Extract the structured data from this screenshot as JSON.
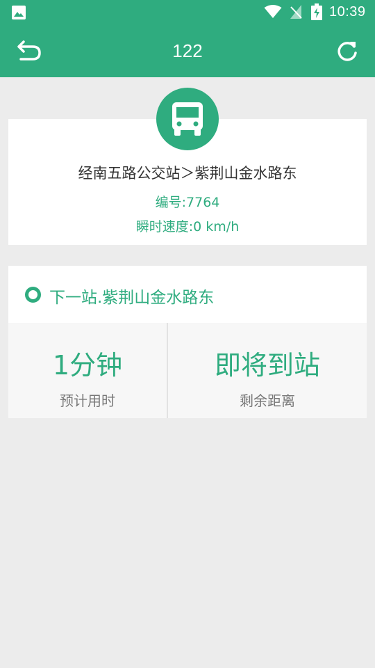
{
  "status_bar": {
    "time": "10:39",
    "icons": [
      "photo-icon",
      "wifi-icon",
      "no-signal-icon",
      "battery-charging-icon"
    ]
  },
  "toolbar": {
    "title": "122",
    "back_icon": "back-icon",
    "refresh_icon": "refresh-icon"
  },
  "bus_info": {
    "icon": "bus-icon",
    "route": "经南五路公交站＞紫荆山金水路东",
    "number": "编号:7764",
    "speed": "瞬时速度:0 km/h"
  },
  "next_stop": {
    "icon": "ring-icon",
    "label": "下一站.紫荆山金水路东"
  },
  "stats": {
    "eta_value": "1分钟",
    "eta_label": "预计用时",
    "distance_value": "即将到站",
    "distance_label": "剩余距离"
  },
  "colors": {
    "accent": "#2fac7f",
    "background": "#ececec",
    "card": "#ffffff"
  }
}
